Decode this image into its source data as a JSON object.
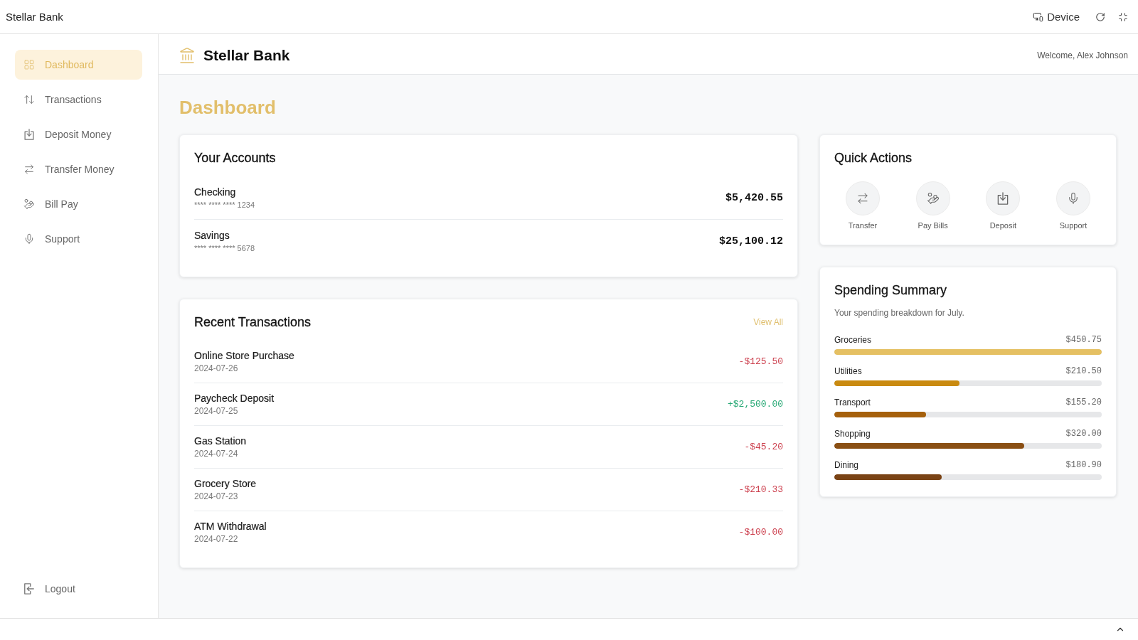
{
  "top_bar": {
    "title": "Stellar Bank",
    "device_button": "Device"
  },
  "sidebar": {
    "items": [
      {
        "label": "Dashboard",
        "selected": true
      },
      {
        "label": "Transactions",
        "selected": false
      },
      {
        "label": "Deposit Money",
        "selected": false
      },
      {
        "label": "Transfer Money",
        "selected": false
      },
      {
        "label": "Bill Pay",
        "selected": false
      },
      {
        "label": "Support",
        "selected": false
      }
    ],
    "logout": "Logout"
  },
  "header": {
    "brand": "Stellar Bank",
    "welcome": "Welcome, Alex Johnson"
  },
  "page_title": "Dashboard",
  "accounts": {
    "title": "Your Accounts",
    "items": [
      {
        "name": "Checking",
        "number": "**** **** **** 1234",
        "balance": "$5,420.55"
      },
      {
        "name": "Savings",
        "number": "**** **** **** 5678",
        "balance": "$25,100.12"
      }
    ]
  },
  "transactions": {
    "title": "Recent Transactions",
    "view_all": "View All",
    "rows": [
      {
        "description": "Online Store Purchase",
        "date": "2024-07-26",
        "amount": "-$125.50",
        "kind": "debit"
      },
      {
        "description": "Paycheck Deposit",
        "date": "2024-07-25",
        "amount": "+$2,500.00",
        "kind": "credit"
      },
      {
        "description": "Gas Station",
        "date": "2024-07-24",
        "amount": "-$45.20",
        "kind": "debit"
      },
      {
        "description": "Grocery Store",
        "date": "2024-07-23",
        "amount": "-$210.33",
        "kind": "debit"
      },
      {
        "description": "ATM Withdrawal",
        "date": "2024-07-22",
        "amount": "-$100.00",
        "kind": "debit"
      }
    ]
  },
  "quick_actions": {
    "title": "Quick Actions",
    "actions": [
      {
        "label": "Transfer"
      },
      {
        "label": "Pay Bills"
      },
      {
        "label": "Deposit"
      },
      {
        "label": "Support"
      }
    ]
  },
  "spending": {
    "title": "Spending Summary",
    "subtitle": "Your spending breakdown for July.",
    "items": [
      {
        "category": "Groceries",
        "amount": "$450.75",
        "level": 1,
        "color": "#e5c063"
      },
      {
        "category": "Utilities",
        "amount": "$210.50",
        "level": 0.467,
        "color": "#c98a10"
      },
      {
        "category": "Transport",
        "amount": "$155.20",
        "level": 0.344,
        "color": "#a5600c"
      },
      {
        "category": "Shopping",
        "amount": "$320.00",
        "level": 0.71,
        "color": "#8a4f14"
      },
      {
        "category": "Dining",
        "amount": "$180.90",
        "level": 0.401,
        "color": "#7a4315"
      }
    ]
  }
}
